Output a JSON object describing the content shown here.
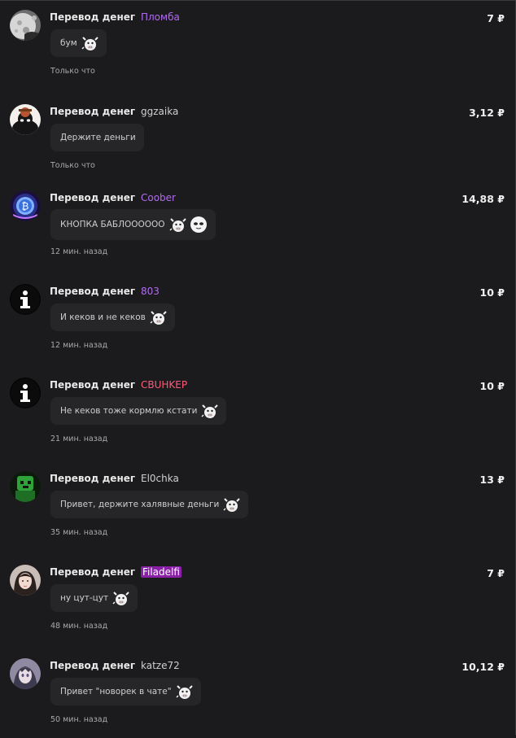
{
  "label": "Перевод денег",
  "colors": {
    "bg": "#1b1b1d",
    "bubble": "#262629",
    "purple": "#b16bf0",
    "red": "#ff5a7a",
    "gray": "#cfcfcf",
    "magenta_bg": "#8a1fa8"
  },
  "items": [
    {
      "avatar": "moon-avatar",
      "user": "Пломба",
      "user_style": "purple",
      "amount": "7 ₽",
      "message": "бум",
      "emojis": [
        "bull-sticker"
      ],
      "time": "Только что"
    },
    {
      "avatar": "coffee-person-avatar",
      "user": "ggzaika",
      "user_style": "gray",
      "amount": "3,12 ₽",
      "message": "Держите деньги",
      "emojis": [],
      "time": "Только что"
    },
    {
      "avatar": "crypto-coin-avatar",
      "user": "Coober",
      "user_style": "purple",
      "amount": "14,88 ₽",
      "message": "КНОПКА БАБЛОООООО",
      "emojis": [
        "bull-sticker",
        "ghost-face-sticker"
      ],
      "time": "12 мин. назад"
    },
    {
      "avatar": "info-avatar",
      "user": "803",
      "user_style": "purple",
      "amount": "10 ₽",
      "message": "И кеков и не кеков",
      "emojis": [
        "bull-sticker"
      ],
      "time": "12 мин. назад"
    },
    {
      "avatar": "info-avatar",
      "user": "CBUHKEP",
      "user_style": "red",
      "amount": "10 ₽",
      "message": "Не кеков тоже кормлю кстати",
      "emojis": [
        "bull-sticker"
      ],
      "time": "21 мин. назад"
    },
    {
      "avatar": "green-creature-avatar",
      "user": "El0chka",
      "user_style": "gray",
      "amount": "13 ₽",
      "message": "Привет, держите халявные деньги",
      "emojis": [
        "bull-sticker"
      ],
      "time": "35 мин. назад"
    },
    {
      "avatar": "girl-avatar",
      "user": "Filadelfi",
      "user_style": "magenta",
      "amount": "7 ₽",
      "message": "ну цут-цут",
      "emojis": [
        "bull-sticker"
      ],
      "time": "48 мин. назад"
    },
    {
      "avatar": "anime-avatar",
      "user": "katze72",
      "user_style": "gray",
      "amount": "10,12 ₽",
      "message": "Привет \"новорек в чате\"",
      "emojis": [
        "bull-sticker"
      ],
      "time": "50 мин. назад"
    }
  ]
}
